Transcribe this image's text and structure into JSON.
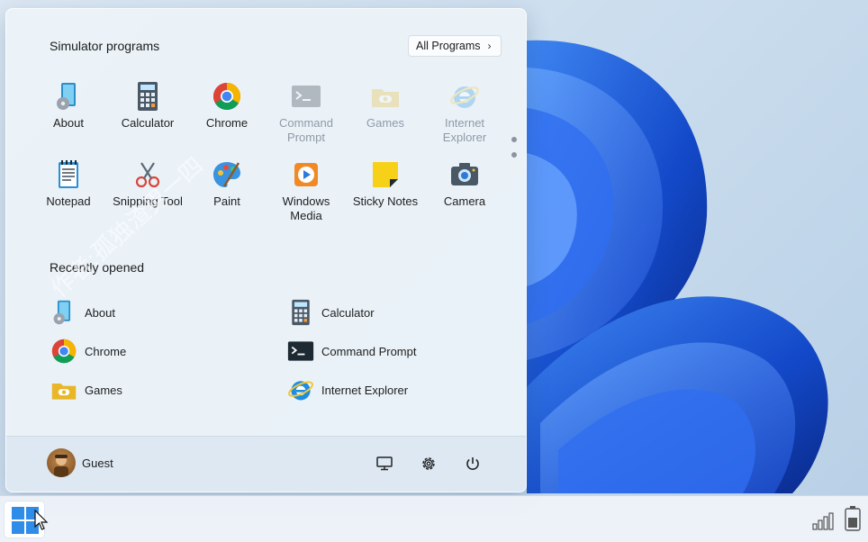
{
  "start_menu": {
    "pinned_title": "Simulator programs",
    "all_programs_label": "All Programs",
    "all_programs_chevron": "›",
    "pinned": [
      {
        "label": "About",
        "icon": "about-icon",
        "dim": false
      },
      {
        "label": "Calculator",
        "icon": "calculator-icon",
        "dim": false
      },
      {
        "label": "Chrome",
        "icon": "chrome-icon",
        "dim": false
      },
      {
        "label": "Command Prompt",
        "icon": "command-prompt-icon",
        "dim": true
      },
      {
        "label": "Games",
        "icon": "games-icon",
        "dim": true
      },
      {
        "label": "Internet Explorer",
        "icon": "internet-explorer-icon",
        "dim": true
      },
      {
        "label": "Notepad",
        "icon": "notepad-icon",
        "dim": false
      },
      {
        "label": "Snipping Tool",
        "icon": "snipping-tool-icon",
        "dim": false
      },
      {
        "label": "Paint",
        "icon": "paint-icon",
        "dim": false
      },
      {
        "label": "Windows Media",
        "icon": "windows-media-icon",
        "dim": false
      },
      {
        "label": "Sticky Notes",
        "icon": "sticky-notes-icon",
        "dim": false
      },
      {
        "label": "Camera",
        "icon": "camera-icon",
        "dim": false
      }
    ],
    "recent_title": "Recently opened",
    "recent": [
      {
        "label": "About",
        "icon": "about-icon"
      },
      {
        "label": "Calculator",
        "icon": "calculator-icon"
      },
      {
        "label": "Chrome",
        "icon": "chrome-icon"
      },
      {
        "label": "Command Prompt",
        "icon": "command-prompt-icon"
      },
      {
        "label": "Games",
        "icon": "games-icon"
      },
      {
        "label": "Internet Explorer",
        "icon": "internet-explorer-icon"
      }
    ],
    "user_name": "Guest",
    "footer_buttons": [
      "display-icon",
      "gear-icon",
      "power-icon"
    ]
  },
  "watermark": "作者:孤独渣男一四",
  "colors": {
    "accent": "#0f6cbd",
    "wallpaper_blue": "#1a56d6"
  },
  "taskbar": {
    "start_icon": "windows-logo-icon",
    "tray": [
      "signal-icon",
      "battery-icon"
    ]
  }
}
